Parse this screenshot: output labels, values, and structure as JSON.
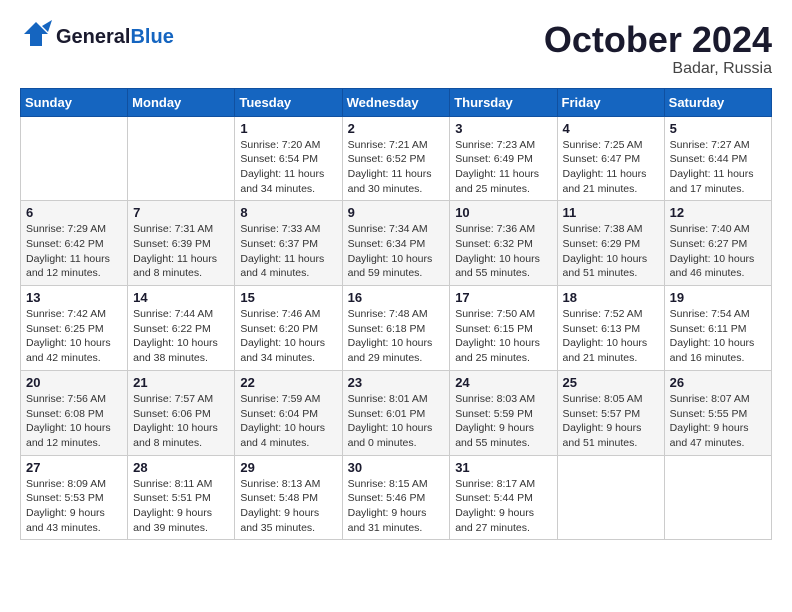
{
  "header": {
    "logo_general": "General",
    "logo_blue": "Blue",
    "month": "October 2024",
    "location": "Badar, Russia"
  },
  "weekdays": [
    "Sunday",
    "Monday",
    "Tuesday",
    "Wednesday",
    "Thursday",
    "Friday",
    "Saturday"
  ],
  "weeks": [
    [
      {
        "day": "",
        "info": ""
      },
      {
        "day": "",
        "info": ""
      },
      {
        "day": "1",
        "info": "Sunrise: 7:20 AM\nSunset: 6:54 PM\nDaylight: 11 hours\nand 34 minutes."
      },
      {
        "day": "2",
        "info": "Sunrise: 7:21 AM\nSunset: 6:52 PM\nDaylight: 11 hours\nand 30 minutes."
      },
      {
        "day": "3",
        "info": "Sunrise: 7:23 AM\nSunset: 6:49 PM\nDaylight: 11 hours\nand 25 minutes."
      },
      {
        "day": "4",
        "info": "Sunrise: 7:25 AM\nSunset: 6:47 PM\nDaylight: 11 hours\nand 21 minutes."
      },
      {
        "day": "5",
        "info": "Sunrise: 7:27 AM\nSunset: 6:44 PM\nDaylight: 11 hours\nand 17 minutes."
      }
    ],
    [
      {
        "day": "6",
        "info": "Sunrise: 7:29 AM\nSunset: 6:42 PM\nDaylight: 11 hours\nand 12 minutes."
      },
      {
        "day": "7",
        "info": "Sunrise: 7:31 AM\nSunset: 6:39 PM\nDaylight: 11 hours\nand 8 minutes."
      },
      {
        "day": "8",
        "info": "Sunrise: 7:33 AM\nSunset: 6:37 PM\nDaylight: 11 hours\nand 4 minutes."
      },
      {
        "day": "9",
        "info": "Sunrise: 7:34 AM\nSunset: 6:34 PM\nDaylight: 10 hours\nand 59 minutes."
      },
      {
        "day": "10",
        "info": "Sunrise: 7:36 AM\nSunset: 6:32 PM\nDaylight: 10 hours\nand 55 minutes."
      },
      {
        "day": "11",
        "info": "Sunrise: 7:38 AM\nSunset: 6:29 PM\nDaylight: 10 hours\nand 51 minutes."
      },
      {
        "day": "12",
        "info": "Sunrise: 7:40 AM\nSunset: 6:27 PM\nDaylight: 10 hours\nand 46 minutes."
      }
    ],
    [
      {
        "day": "13",
        "info": "Sunrise: 7:42 AM\nSunset: 6:25 PM\nDaylight: 10 hours\nand 42 minutes."
      },
      {
        "day": "14",
        "info": "Sunrise: 7:44 AM\nSunset: 6:22 PM\nDaylight: 10 hours\nand 38 minutes."
      },
      {
        "day": "15",
        "info": "Sunrise: 7:46 AM\nSunset: 6:20 PM\nDaylight: 10 hours\nand 34 minutes."
      },
      {
        "day": "16",
        "info": "Sunrise: 7:48 AM\nSunset: 6:18 PM\nDaylight: 10 hours\nand 29 minutes."
      },
      {
        "day": "17",
        "info": "Sunrise: 7:50 AM\nSunset: 6:15 PM\nDaylight: 10 hours\nand 25 minutes."
      },
      {
        "day": "18",
        "info": "Sunrise: 7:52 AM\nSunset: 6:13 PM\nDaylight: 10 hours\nand 21 minutes."
      },
      {
        "day": "19",
        "info": "Sunrise: 7:54 AM\nSunset: 6:11 PM\nDaylight: 10 hours\nand 16 minutes."
      }
    ],
    [
      {
        "day": "20",
        "info": "Sunrise: 7:56 AM\nSunset: 6:08 PM\nDaylight: 10 hours\nand 12 minutes."
      },
      {
        "day": "21",
        "info": "Sunrise: 7:57 AM\nSunset: 6:06 PM\nDaylight: 10 hours\nand 8 minutes."
      },
      {
        "day": "22",
        "info": "Sunrise: 7:59 AM\nSunset: 6:04 PM\nDaylight: 10 hours\nand 4 minutes."
      },
      {
        "day": "23",
        "info": "Sunrise: 8:01 AM\nSunset: 6:01 PM\nDaylight: 10 hours\nand 0 minutes."
      },
      {
        "day": "24",
        "info": "Sunrise: 8:03 AM\nSunset: 5:59 PM\nDaylight: 9 hours\nand 55 minutes."
      },
      {
        "day": "25",
        "info": "Sunrise: 8:05 AM\nSunset: 5:57 PM\nDaylight: 9 hours\nand 51 minutes."
      },
      {
        "day": "26",
        "info": "Sunrise: 8:07 AM\nSunset: 5:55 PM\nDaylight: 9 hours\nand 47 minutes."
      }
    ],
    [
      {
        "day": "27",
        "info": "Sunrise: 8:09 AM\nSunset: 5:53 PM\nDaylight: 9 hours\nand 43 minutes."
      },
      {
        "day": "28",
        "info": "Sunrise: 8:11 AM\nSunset: 5:51 PM\nDaylight: 9 hours\nand 39 minutes."
      },
      {
        "day": "29",
        "info": "Sunrise: 8:13 AM\nSunset: 5:48 PM\nDaylight: 9 hours\nand 35 minutes."
      },
      {
        "day": "30",
        "info": "Sunrise: 8:15 AM\nSunset: 5:46 PM\nDaylight: 9 hours\nand 31 minutes."
      },
      {
        "day": "31",
        "info": "Sunrise: 8:17 AM\nSunset: 5:44 PM\nDaylight: 9 hours\nand 27 minutes."
      },
      {
        "day": "",
        "info": ""
      },
      {
        "day": "",
        "info": ""
      }
    ]
  ]
}
